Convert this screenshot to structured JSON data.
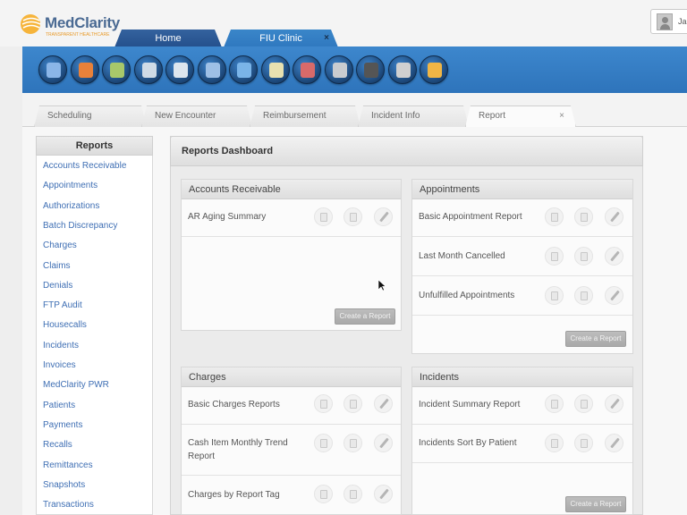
{
  "app": {
    "logo_text": "MedClarity",
    "logo_tagline": "TRANSPARENT HEALTHCARE",
    "user_name": "Ja"
  },
  "main_tabs": [
    {
      "label": "Home"
    },
    {
      "label": "FIU Clinic",
      "close": "×"
    }
  ],
  "toolbar_icons": [
    {
      "icon": "patients-icon",
      "color": "#8bb6e8"
    },
    {
      "icon": "calendar-icon",
      "color": "#e8813a"
    },
    {
      "icon": "money-icon",
      "color": "#a8c86a"
    },
    {
      "icon": "document-icon",
      "color": "#cfdbe6"
    },
    {
      "icon": "stopwatch-icon",
      "color": "#dde6ee"
    },
    {
      "icon": "doctor-icon",
      "color": "#9ec0e6"
    },
    {
      "icon": "billing-icon",
      "color": "#7ab4e8"
    },
    {
      "icon": "notes-icon",
      "color": "#e8e1b0"
    },
    {
      "icon": "staff-icon",
      "color": "#d86a6a"
    },
    {
      "icon": "files-icon",
      "color": "#c9ccd0"
    },
    {
      "icon": "disk-icon",
      "color": "#555555"
    },
    {
      "icon": "airplane-icon",
      "color": "#d0d0d0"
    },
    {
      "icon": "reports-chart-icon",
      "color": "#f0b545"
    }
  ],
  "sub_tabs": [
    {
      "label": "Scheduling"
    },
    {
      "label": "New Encounter"
    },
    {
      "label": "Reimbursement"
    },
    {
      "label": "Incident Info"
    },
    {
      "label": "Report",
      "close": "×"
    }
  ],
  "sidebar": {
    "title": "Reports",
    "items": [
      "Accounts Receivable",
      "Appointments",
      "Authorizations",
      "Batch Discrepancy",
      "Charges",
      "Claims",
      "Denials",
      "FTP Audit",
      "Housecalls",
      "Incidents",
      "Invoices",
      "MedClarity PWR",
      "Patients",
      "Payments",
      "Recalls",
      "Remittances",
      "Snapshots",
      "Transactions"
    ]
  },
  "dashboard": {
    "title": "Reports Dashboard",
    "create_label": "Create a Report",
    "panels": [
      {
        "title": "Accounts Receivable",
        "rows": [
          "AR Aging Summary"
        ]
      },
      {
        "title": "Appointments",
        "rows": [
          "Basic Appointment Report",
          "Last Month Cancelled",
          "Unfulfilled Appointments"
        ]
      },
      {
        "title": "Charges",
        "rows": [
          "Basic Charges Reports",
          "Cash Item Monthly Trend Report",
          "Charges by Report Tag"
        ]
      },
      {
        "title": "Incidents",
        "rows": [
          "Incident Summary Report",
          "Incidents Sort By Patient"
        ]
      }
    ]
  }
}
